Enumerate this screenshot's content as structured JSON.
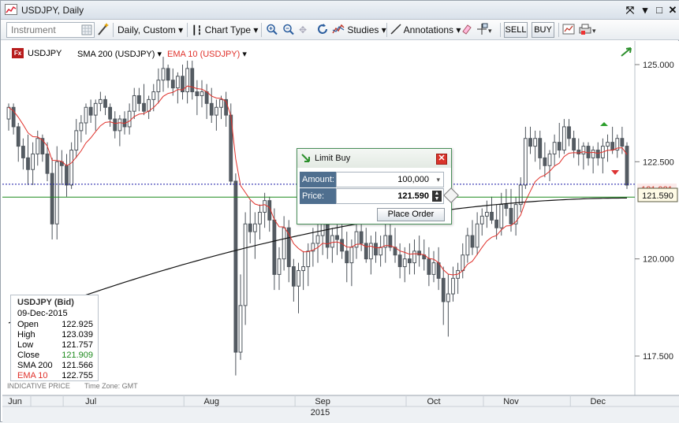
{
  "window": {
    "title": "USDJPY, Daily"
  },
  "toolbar": {
    "instrument_placeholder": "Instrument",
    "period_label": "Daily,  Custom",
    "chart_type_label": "Chart Type",
    "studies_label": "Studies",
    "annotations_label": "Annotations",
    "sell_label": "SELL",
    "buy_label": "BUY"
  },
  "legend": {
    "instrument": "USDJPY",
    "sma": "SMA 200 (USDJPY)",
    "ema": "EMA 10 (USDJPY)",
    "instrument_badge": "Fx"
  },
  "colors": {
    "ema": "#e0302a",
    "sma": "#111111",
    "candle": "#555c63",
    "hline": "#1d8a1d",
    "dotline": "#1a1aa8",
    "dialog_border": "#4a8f5a"
  },
  "order_dialog": {
    "title": "Limit Buy",
    "amount_label": "Amount:",
    "amount_value": "100,000",
    "price_label": "Price:",
    "price_value": "121.590",
    "place_order_label": "Place Order"
  },
  "price_tags": {
    "current": "121.921",
    "order": "121.590"
  },
  "footer": {
    "indicative": "INDICATIVE PRICE",
    "timezone": "Time Zone: GMT",
    "year": "2015"
  },
  "info_box": {
    "title": "USDJPY (Bid)",
    "date": "09-Dec-2015",
    "rows": [
      {
        "label": "Open",
        "value": "122.925"
      },
      {
        "label": "High",
        "value": "123.039"
      },
      {
        "label": "Low",
        "value": "121.757"
      },
      {
        "label": "Close",
        "value": "121.909"
      },
      {
        "label": "SMA 200",
        "value": "121.566"
      },
      {
        "label": "EMA 10",
        "value": "122.755"
      }
    ]
  },
  "chart_data": {
    "type": "candlestick",
    "title": "USDJPY, Daily",
    "y_ticks": [
      "125.000",
      "122.500",
      "120.000",
      "117.500"
    ],
    "ylim": [
      116.5,
      125.4
    ],
    "x_ticks": [
      "Jun",
      "Jul",
      "Aug",
      "Sep",
      "Oct",
      "Nov",
      "Dec"
    ],
    "horizontal_lines": {
      "limit_order_price": 121.59,
      "current_bid": 121.921
    },
    "candles": [
      [
        123.6,
        124.0,
        123.3,
        123.9
      ],
      [
        123.9,
        124.0,
        123.2,
        123.4
      ],
      [
        123.4,
        123.5,
        122.5,
        122.9
      ],
      [
        122.9,
        123.1,
        122.3,
        122.6
      ],
      [
        122.6,
        123.2,
        121.9,
        122.3
      ],
      [
        122.3,
        123.0,
        121.9,
        122.7
      ],
      [
        122.7,
        123.3,
        122.4,
        123.1
      ],
      [
        123.1,
        123.2,
        122.5,
        122.7
      ],
      [
        122.7,
        123.0,
        122.0,
        122.2
      ],
      [
        122.2,
        122.6,
        120.5,
        120.9
      ],
      [
        120.9,
        122.9,
        120.5,
        122.5
      ],
      [
        122.5,
        122.8,
        121.9,
        122.4
      ],
      [
        122.4,
        122.7,
        121.6,
        121.9
      ],
      [
        121.9,
        123.0,
        121.8,
        122.8
      ],
      [
        122.8,
        123.6,
        122.6,
        123.3
      ],
      [
        123.3,
        123.7,
        123.0,
        123.5
      ],
      [
        123.5,
        124.0,
        123.2,
        123.9
      ],
      [
        123.9,
        124.1,
        123.5,
        123.7
      ],
      [
        123.7,
        124.1,
        123.3,
        124.0
      ],
      [
        124.0,
        124.3,
        123.8,
        124.1
      ],
      [
        124.1,
        124.2,
        123.7,
        123.9
      ],
      [
        123.9,
        124.0,
        123.4,
        123.6
      ],
      [
        123.6,
        123.8,
        123.1,
        123.3
      ],
      [
        123.3,
        123.7,
        122.9,
        123.6
      ],
      [
        123.6,
        123.8,
        123.2,
        123.4
      ],
      [
        123.4,
        124.0,
        123.2,
        123.8
      ],
      [
        123.8,
        124.4,
        123.6,
        124.2
      ],
      [
        124.2,
        124.4,
        123.8,
        124.0
      ],
      [
        124.0,
        124.5,
        123.7,
        123.8
      ],
      [
        123.8,
        124.2,
        123.6,
        124.1
      ],
      [
        124.1,
        124.5,
        123.8,
        124.3
      ],
      [
        124.3,
        124.9,
        124.0,
        124.6
      ],
      [
        124.6,
        125.2,
        124.3,
        124.9
      ],
      [
        124.9,
        125.0,
        124.4,
        124.6
      ],
      [
        124.6,
        124.9,
        124.2,
        124.4
      ],
      [
        124.4,
        124.8,
        124.0,
        124.7
      ],
      [
        124.7,
        125.0,
        124.1,
        124.3
      ],
      [
        124.3,
        125.1,
        124.0,
        124.9
      ],
      [
        124.9,
        125.1,
        124.1,
        124.3
      ],
      [
        124.3,
        124.6,
        123.7,
        124.2
      ],
      [
        124.2,
        124.6,
        123.9,
        124.3
      ],
      [
        124.3,
        124.5,
        123.6,
        124.0
      ],
      [
        124.0,
        124.4,
        123.5,
        123.7
      ],
      [
        123.7,
        124.1,
        123.3,
        123.9
      ],
      [
        123.9,
        124.2,
        123.6,
        124.1
      ],
      [
        124.1,
        124.3,
        123.4,
        123.7
      ],
      [
        123.7,
        124.0,
        121.9,
        122.0
      ],
      [
        122.0,
        122.2,
        117.0,
        117.6
      ],
      [
        117.6,
        119.6,
        117.4,
        118.8
      ],
      [
        118.8,
        121.2,
        118.3,
        120.9
      ],
      [
        120.9,
        121.5,
        120.4,
        120.7
      ],
      [
        120.7,
        121.2,
        120.0,
        120.9
      ],
      [
        120.9,
        121.4,
        120.5,
        121.2
      ],
      [
        121.2,
        121.7,
        120.8,
        121.5
      ],
      [
        121.5,
        121.6,
        120.7,
        121.0
      ],
      [
        121.0,
        121.3,
        119.2,
        119.6
      ],
      [
        119.6,
        120.3,
        119.2,
        120.0
      ],
      [
        120.0,
        121.1,
        119.7,
        120.8
      ],
      [
        120.8,
        121.0,
        119.4,
        119.8
      ],
      [
        119.8,
        120.0,
        118.9,
        119.3
      ],
      [
        119.3,
        119.9,
        118.6,
        119.7
      ],
      [
        119.7,
        120.2,
        119.2,
        119.8
      ],
      [
        119.8,
        120.4,
        119.3,
        120.2
      ],
      [
        120.2,
        120.8,
        119.8,
        120.4
      ],
      [
        120.4,
        120.9,
        119.9,
        120.6
      ],
      [
        120.6,
        121.1,
        120.1,
        120.9
      ],
      [
        120.9,
        121.1,
        120.0,
        120.3
      ],
      [
        120.3,
        120.8,
        119.9,
        120.6
      ],
      [
        120.6,
        121.0,
        120.1,
        120.5
      ],
      [
        120.5,
        120.9,
        120.0,
        120.2
      ],
      [
        120.2,
        120.7,
        119.4,
        119.9
      ],
      [
        119.9,
        120.5,
        119.3,
        120.3
      ],
      [
        120.3,
        120.9,
        120.0,
        120.7
      ],
      [
        120.7,
        121.0,
        120.2,
        120.4
      ],
      [
        120.4,
        120.8,
        119.9,
        120.0
      ],
      [
        120.0,
        120.6,
        119.6,
        120.4
      ],
      [
        120.4,
        120.7,
        119.9,
        120.1
      ],
      [
        120.1,
        120.6,
        119.8,
        120.3
      ],
      [
        120.3,
        120.9,
        119.9,
        120.6
      ],
      [
        120.6,
        120.9,
        120.2,
        120.3
      ],
      [
        120.3,
        120.8,
        119.9,
        120.1
      ],
      [
        120.1,
        120.4,
        119.5,
        119.8
      ],
      [
        119.8,
        120.3,
        119.4,
        120.0
      ],
      [
        120.0,
        120.4,
        119.6,
        119.9
      ],
      [
        119.9,
        120.5,
        119.6,
        120.2
      ],
      [
        120.2,
        120.6,
        119.8,
        120.1
      ],
      [
        120.1,
        120.5,
        119.7,
        120.0
      ],
      [
        120.0,
        120.3,
        119.3,
        119.6
      ],
      [
        119.6,
        120.2,
        119.4,
        119.9
      ],
      [
        119.9,
        120.3,
        119.2,
        119.5
      ],
      [
        119.5,
        119.8,
        118.3,
        118.9
      ],
      [
        118.9,
        119.6,
        118.0,
        119.1
      ],
      [
        119.1,
        119.8,
        118.9,
        119.5
      ],
      [
        119.5,
        119.9,
        119.1,
        119.7
      ],
      [
        119.7,
        120.4,
        119.5,
        120.1
      ],
      [
        120.1,
        120.8,
        119.9,
        120.6
      ],
      [
        120.6,
        121.0,
        120.1,
        120.3
      ],
      [
        120.3,
        121.2,
        120.1,
        120.9
      ],
      [
        120.9,
        121.3,
        120.6,
        121.1
      ],
      [
        121.1,
        121.5,
        120.8,
        121.2
      ],
      [
        121.2,
        121.6,
        120.9,
        121.0
      ],
      [
        121.0,
        121.4,
        120.5,
        120.8
      ],
      [
        120.8,
        121.7,
        120.6,
        121.4
      ],
      [
        121.4,
        121.8,
        121.1,
        121.3
      ],
      [
        121.3,
        121.8,
        120.7,
        120.9
      ],
      [
        120.9,
        121.6,
        120.6,
        121.4
      ],
      [
        121.4,
        122.1,
        121.2,
        121.9
      ],
      [
        121.9,
        123.4,
        121.8,
        123.1
      ],
      [
        123.1,
        123.4,
        122.7,
        122.9
      ],
      [
        122.9,
        123.3,
        122.5,
        123.1
      ],
      [
        123.1,
        123.3,
        122.3,
        122.6
      ],
      [
        122.6,
        123.0,
        122.1,
        122.4
      ],
      [
        122.4,
        122.8,
        122.0,
        122.7
      ],
      [
        122.7,
        123.2,
        122.4,
        123.0
      ],
      [
        123.0,
        123.5,
        122.6,
        122.8
      ],
      [
        122.8,
        123.6,
        122.7,
        123.4
      ],
      [
        123.4,
        123.6,
        122.9,
        123.1
      ],
      [
        123.1,
        123.3,
        122.6,
        122.8
      ],
      [
        122.8,
        123.1,
        122.4,
        122.7
      ],
      [
        122.7,
        123.0,
        122.3,
        122.9
      ],
      [
        122.9,
        123.0,
        122.4,
        122.6
      ],
      [
        122.6,
        122.9,
        122.2,
        122.8
      ],
      [
        122.8,
        123.0,
        122.4,
        122.6
      ],
      [
        122.6,
        123.1,
        122.2,
        122.9
      ],
      [
        122.9,
        123.2,
        122.5,
        123.0
      ],
      [
        123.0,
        123.4,
        122.7,
        122.8
      ],
      [
        122.8,
        123.2,
        122.6,
        123.1
      ],
      [
        123.1,
        123.4,
        122.7,
        122.9
      ],
      [
        122.9,
        123.0,
        121.8,
        121.9
      ]
    ]
  }
}
